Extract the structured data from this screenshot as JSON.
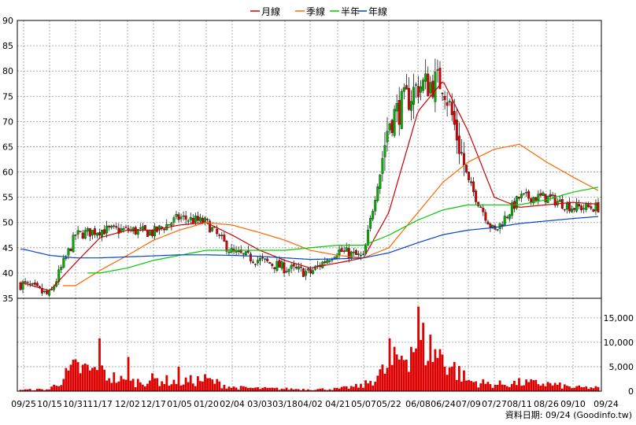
{
  "source_text": "資料日期: 09/24  (Goodinfo.tw)",
  "legend": [
    {
      "label": "月線",
      "color": "#cc0000"
    },
    {
      "label": "季線",
      "color": "#ff6600"
    },
    {
      "label": "半年",
      "color": "#00cc00"
    },
    {
      "label": "年線",
      "color": "#0044cc"
    }
  ],
  "colors": {
    "up": "#00b000",
    "down": "#dd0000",
    "grid": "#999999",
    "frame": "#000000"
  },
  "chart_data": [
    {
      "type": "candlestick",
      "title": "",
      "ylim": [
        35,
        90
      ],
      "yticks": [
        35,
        40,
        45,
        50,
        55,
        60,
        65,
        70,
        75,
        80,
        85,
        90
      ],
      "grid": true,
      "legend_position": "top-center",
      "x_tick_labels": [
        "09/25",
        "10/15",
        "10/31",
        "11/17",
        "12/02",
        "12/17",
        "01/05",
        "01/20",
        "02/04",
        "03/03",
        "03/18",
        "04/02",
        "04/21",
        "05/07",
        "05/22",
        "06/08",
        "06/24",
        "07/09",
        "07/27",
        "08/11",
        "08/26",
        "09/10",
        "09/24"
      ],
      "price_anchors": {
        "dates": [
          "09/25",
          "10/15",
          "10/31",
          "11/17",
          "12/02",
          "12/17",
          "01/05",
          "01/20",
          "02/04",
          "03/03",
          "03/18",
          "04/02",
          "04/21",
          "05/07",
          "05/22",
          "06/08",
          "06/24",
          "07/09",
          "07/27",
          "08/11",
          "08/26",
          "09/10",
          "09/24"
        ],
        "close": [
          37.8,
          35.5,
          47.5,
          48.5,
          48.5,
          48.0,
          51.0,
          50.0,
          44.0,
          42.5,
          41.0,
          40.0,
          44.5,
          43.0,
          70.0,
          77.0,
          78.0,
          58.0,
          48.0,
          55.0,
          55.0,
          53.0,
          53.0
        ]
      },
      "series": [
        {
          "name": "月線",
          "values": [
            38.0,
            36.5,
            42.0,
            47.0,
            48.5,
            48.5,
            49.5,
            50.0,
            47.5,
            44.5,
            42.5,
            41.0,
            42.0,
            43.0,
            52.0,
            72.0,
            78.0,
            68.0,
            55.0,
            53.0,
            53.5,
            54.0,
            53.5
          ]
        },
        {
          "name": "季線",
          "values": [
            null,
            null,
            37.5,
            40.5,
            43.5,
            46.5,
            48.5,
            50.0,
            49.5,
            48.0,
            46.5,
            44.5,
            43.5,
            43.0,
            45.0,
            52.0,
            58.0,
            62.0,
            64.5,
            65.5,
            62.0,
            59.0,
            55.5
          ]
        },
        {
          "name": "半年",
          "values": [
            null,
            null,
            null,
            40.0,
            41.0,
            42.5,
            43.5,
            44.5,
            44.5,
            44.5,
            44.5,
            45.0,
            45.5,
            45.5,
            47.5,
            50.5,
            52.5,
            53.5,
            53.5,
            53.5,
            54.5,
            56.0,
            57.3
          ]
        },
        {
          "name": "年線",
          "values": [
            44.7,
            43.5,
            43.0,
            43.0,
            43.2,
            43.4,
            43.6,
            43.6,
            43.5,
            43.3,
            43.0,
            42.7,
            42.8,
            43.0,
            44.0,
            46.0,
            47.6,
            48.5,
            49.0,
            49.8,
            50.3,
            50.8,
            51.3
          ]
        }
      ]
    },
    {
      "type": "bar",
      "title": "",
      "ylim": [
        0,
        19000
      ],
      "yticks": [
        0,
        5000,
        10000,
        15000
      ],
      "ytick_labels": [
        "0",
        "5,000",
        "10,000",
        "15,000"
      ],
      "volume_anchors": {
        "dates": [
          "09/25",
          "10/15",
          "10/31",
          "11/17",
          "12/02",
          "12/17",
          "01/05",
          "01/20",
          "02/04",
          "03/03",
          "03/18",
          "04/02",
          "04/21",
          "05/07",
          "05/22",
          "06/08",
          "06/24",
          "07/09",
          "07/27",
          "08/11",
          "08/26",
          "09/10",
          "09/24"
        ],
        "values": [
          300,
          400,
          5000,
          4000,
          1800,
          2500,
          2000,
          2500,
          800,
          600,
          500,
          400,
          500,
          1200,
          5000,
          11000,
          7000,
          2200,
          1400,
          1800,
          1600,
          800,
          700
        ]
      },
      "peaks": [
        {
          "date": "10/31",
          "value": 6500
        },
        {
          "date": "11/17",
          "value": 10800
        },
        {
          "date": "12/02",
          "value": 7000
        },
        {
          "date": "01/05",
          "value": 5000
        },
        {
          "date": "05/22",
          "value": 10800
        },
        {
          "date": "06/08",
          "value": 17300
        },
        {
          "date": "06/24",
          "value": 7500
        }
      ]
    }
  ]
}
